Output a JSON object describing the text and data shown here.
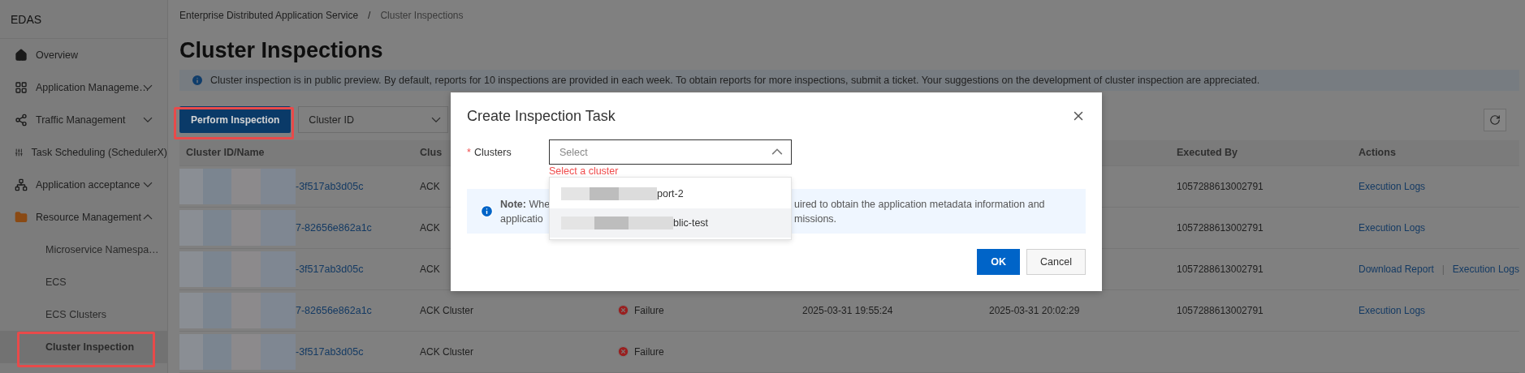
{
  "sidebar": {
    "title": "EDAS",
    "items": [
      {
        "label": "Overview",
        "kind": "link"
      },
      {
        "label": "Application Manageme…",
        "kind": "group",
        "expanded": false
      },
      {
        "label": "Traffic Management",
        "kind": "group",
        "expanded": false
      },
      {
        "label": "Task Scheduling (SchedulerX)",
        "kind": "link"
      },
      {
        "label": "Application acceptance",
        "kind": "group",
        "expanded": false
      },
      {
        "label": "Resource Management",
        "kind": "group",
        "expanded": true,
        "children": [
          {
            "label": "Microservice Namespa…",
            "selected": false,
            "highlighted": false
          },
          {
            "label": "ECS",
            "selected": false,
            "highlighted": false
          },
          {
            "label": "ECS Clusters",
            "selected": false,
            "highlighted": false
          },
          {
            "label": "Cluster Inspection",
            "selected": true,
            "highlighted": true
          }
        ]
      }
    ]
  },
  "breadcrumb": {
    "items": [
      "Enterprise Distributed Application Service",
      "Cluster Inspections"
    ],
    "separator": "/"
  },
  "title": "Cluster Inspections",
  "notice": "Cluster inspection is in public preview. By default, reports for 10 inspections are provided in each week. To obtain reports for more inspections, submit a ticket. Your suggestions on the development of cluster inspection are appreciated.",
  "toolbar": {
    "primary_button": {
      "label": "Perform Inspection",
      "highlighted": true
    },
    "filter": {
      "value": "Cluster ID"
    }
  },
  "table": {
    "columns": {
      "column_1": "Cluster ID/Name",
      "column_2": "Clus",
      "column_6": "Executed By",
      "column_7": "Actions"
    },
    "rows": [
      {
        "cluster_id": "-3f517ab3d05c",
        "column_2": "ACK",
        "executed_by": "1057288613002791",
        "actions": [
          "Execution Logs"
        ]
      },
      {
        "cluster_id": "7-82656e862a1c",
        "column_2": "ACK",
        "executed_by": "1057288613002791",
        "actions": [
          "Execution Logs"
        ]
      },
      {
        "cluster_id": "-3f517ab3d05c",
        "column_2": "ACK",
        "executed_by": "1057288613002791",
        "actions": [
          "Download Report",
          "Execution Logs"
        ],
        "action_separator": "|"
      },
      {
        "cluster_id": "7-82656e862a1c",
        "column_2": "ACK Cluster",
        "status": {
          "label": "Failure",
          "kind": "failure"
        },
        "column_4": "2025-03-31 19:55:24",
        "column_5": "2025-03-31 20:02:29",
        "executed_by": "1057288613002791",
        "actions": [
          "Execution Logs"
        ]
      },
      {
        "cluster_id": "-3f517ab3d05c",
        "column_2": "ACK Cluster",
        "status": {
          "label": "Failure",
          "kind": "failure"
        }
      }
    ]
  },
  "dialog": {
    "title": "Create Inspection Task",
    "field": {
      "required_mark": "*",
      "label": "Clusters",
      "placeholder": "Select",
      "expanded": true,
      "error": "Select a cluster",
      "options": [
        {
          "label": "port-2",
          "highlighted": false
        },
        {
          "label": "blic-test",
          "highlighted": true
        }
      ]
    },
    "note": {
      "lines": [
        {
          "left": "**Note:** Whe",
          "right": "uired to obtain the application metadata information and"
        },
        {
          "left": "applicatio",
          "right": "missions."
        }
      ]
    },
    "buttons": [
      {
        "label": "OK",
        "kind": "primary"
      },
      {
        "label": "Cancel",
        "kind": "secondary"
      }
    ]
  }
}
